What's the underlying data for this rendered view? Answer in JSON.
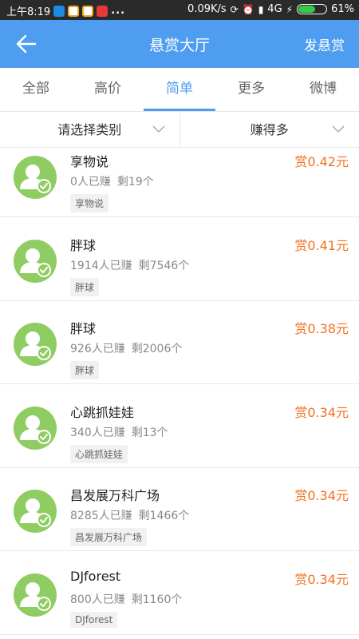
{
  "status_bar": {
    "time": "上午8:19",
    "network_speed": "0.09K/s",
    "network_type": "4G",
    "battery": "61%",
    "battery_level": 0.61,
    "more": "..."
  },
  "header": {
    "title": "悬赏大厅",
    "action_label": "发悬赏",
    "back_icon": "arrow-left-icon",
    "background_color": "#4f9df0"
  },
  "tabs": [
    {
      "label": "全部",
      "active": false
    },
    {
      "label": "高价",
      "active": false
    },
    {
      "label": "简单",
      "active": true
    },
    {
      "label": "更多",
      "active": false
    },
    {
      "label": "微博",
      "active": false
    }
  ],
  "filters": {
    "category": "请选择类别",
    "sort": "赚得多"
  },
  "tasks": [
    {
      "title": "享物说",
      "earned": "0人已赚",
      "remaining": "剩19个",
      "tag": "享物说",
      "reward": "赏0.42元"
    },
    {
      "title": "胖球",
      "earned": "1914人已赚",
      "remaining": "剩7546个",
      "tag": "胖球",
      "reward": "赏0.41元"
    },
    {
      "title": "胖球",
      "earned": "926人已赚",
      "remaining": "剩2006个",
      "tag": "胖球",
      "reward": "赏0.38元"
    },
    {
      "title": "心跳抓娃娃",
      "earned": "340人已赚",
      "remaining": "剩13个",
      "tag": "心跳抓娃娃",
      "reward": "赏0.34元"
    },
    {
      "title": "昌发展万科广场",
      "earned": "8285人已赚",
      "remaining": "剩1466个",
      "tag": "昌发展万科广场",
      "reward": "赏0.34元"
    },
    {
      "title": "DJforest",
      "earned": "800人已赚",
      "remaining": "剩1160个",
      "tag": "DJforest",
      "reward": "赏0.34元"
    }
  ],
  "colors": {
    "accent": "#4f9df0",
    "reward": "#f2701d",
    "avatar": "#8fcc62"
  }
}
